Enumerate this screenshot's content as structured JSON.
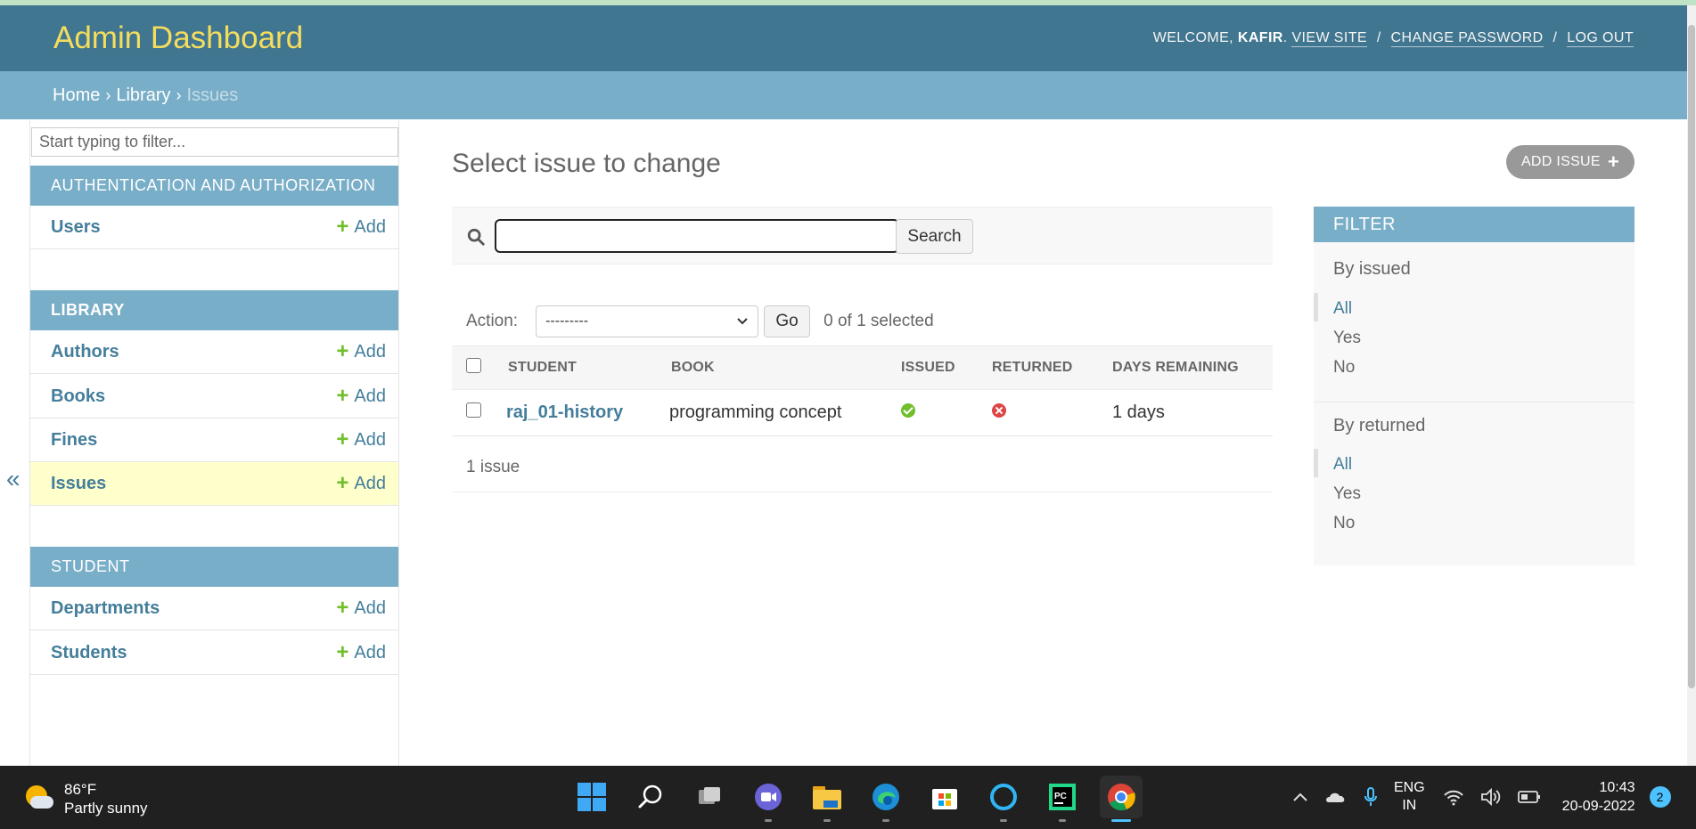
{
  "header": {
    "brand": "Admin Dashboard",
    "welcome": "WELCOME,",
    "username": "KAFIR",
    "view_site": "VIEW SITE",
    "change_password": "CHANGE PASSWORD",
    "log_out": "LOG OUT",
    "sep": "/"
  },
  "breadcrumbs": {
    "home": "Home",
    "library": "Library",
    "current": "Issues",
    "sep": "›"
  },
  "sidebar": {
    "filter_placeholder": "Start typing to filter...",
    "collapse": "«",
    "modules": [
      {
        "caption": "AUTHENTICATION AND AUTHORIZATION",
        "models": [
          {
            "name": "Users",
            "add": "Add"
          }
        ]
      },
      {
        "caption": "LIBRARY",
        "models": [
          {
            "name": "Authors",
            "add": "Add"
          },
          {
            "name": "Books",
            "add": "Add"
          },
          {
            "name": "Fines",
            "add": "Add"
          },
          {
            "name": "Issues",
            "add": "Add",
            "active": true
          }
        ]
      },
      {
        "caption": "STUDENT",
        "models": [
          {
            "name": "Departments",
            "add": "Add"
          },
          {
            "name": "Students",
            "add": "Add"
          }
        ]
      }
    ]
  },
  "main": {
    "title": "Select issue to change",
    "add_button": "ADD ISSUE",
    "search_button": "Search",
    "search_value": "",
    "action_label": "Action:",
    "action_selected": "---------",
    "go_button": "Go",
    "selected_count": "0 of 1 selected",
    "columns": [
      "STUDENT",
      "BOOK",
      "ISSUED",
      "RETURNED",
      "DAYS REMAINING"
    ],
    "rows": [
      {
        "student": "raj_01-history",
        "book": "programming concept",
        "issued": true,
        "returned": false,
        "days_remaining": "1 days"
      }
    ],
    "paginator": "1 issue"
  },
  "filter": {
    "title": "FILTER",
    "groups": [
      {
        "heading": "By issued",
        "options": [
          "All",
          "Yes",
          "No"
        ],
        "selected": "All"
      },
      {
        "heading": "By returned",
        "options": [
          "All",
          "Yes",
          "No"
        ],
        "selected": "All"
      }
    ]
  },
  "taskbar": {
    "temperature": "86°F",
    "weather": "Partly sunny",
    "lang_top": "ENG",
    "lang_bottom": "IN",
    "time": "10:43",
    "date": "20-09-2022",
    "notifications": "2",
    "apps": [
      "windows-start",
      "search",
      "task-view",
      "teams-chat",
      "file-explorer",
      "edge",
      "microsoft-store",
      "cortana",
      "pycharm",
      "chrome"
    ]
  },
  "colors": {
    "header_bg": "#417690",
    "brand": "#f5dd5d",
    "breadcrumb_bg": "#79aec8",
    "link": "#447e9b",
    "add_green": "#70bf2b",
    "active_row": "#ffffcc",
    "error_red": "#dd4646"
  }
}
